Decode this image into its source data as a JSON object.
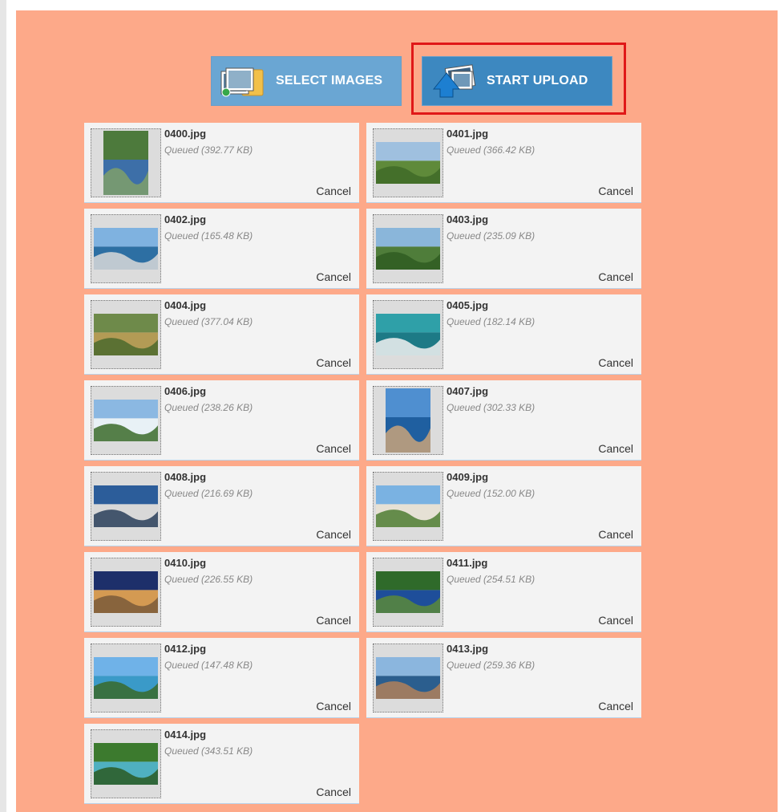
{
  "toolbar": {
    "select_label": "SELECT IMAGES",
    "start_label": "START UPLOAD"
  },
  "files": [
    {
      "name": "0400.jpg",
      "status": "Queued (392.77 KB)",
      "cancel": "Cancel",
      "orientation": "portrait",
      "scene": "canyon-river"
    },
    {
      "name": "0401.jpg",
      "status": "Queued (366.42 KB)",
      "cancel": "Cancel",
      "orientation": "landscape",
      "scene": "vineyard"
    },
    {
      "name": "0402.jpg",
      "status": "Queued (165.48 KB)",
      "cancel": "Cancel",
      "orientation": "landscape",
      "scene": "bridge-sea"
    },
    {
      "name": "0403.jpg",
      "status": "Queued (235.09 KB)",
      "cancel": "Cancel",
      "orientation": "landscape",
      "scene": "valley-fields"
    },
    {
      "name": "0404.jpg",
      "status": "Queued (377.04 KB)",
      "cancel": "Cancel",
      "orientation": "landscape",
      "scene": "terraced-fields"
    },
    {
      "name": "0405.jpg",
      "status": "Queued (182.14 KB)",
      "cancel": "Cancel",
      "orientation": "landscape",
      "scene": "boat-lagoon"
    },
    {
      "name": "0406.jpg",
      "status": "Queued (238.26 KB)",
      "cancel": "Cancel",
      "orientation": "landscape",
      "scene": "waterfall"
    },
    {
      "name": "0407.jpg",
      "status": "Queued (302.33 KB)",
      "cancel": "Cancel",
      "orientation": "portrait",
      "scene": "coastal-town"
    },
    {
      "name": "0408.jpg",
      "status": "Queued (216.69 KB)",
      "cancel": "Cancel",
      "orientation": "landscape",
      "scene": "marina"
    },
    {
      "name": "0409.jpg",
      "status": "Queued (152.00 KB)",
      "cancel": "Cancel",
      "orientation": "landscape",
      "scene": "tower-hill"
    },
    {
      "name": "0410.jpg",
      "status": "Queued (226.55 KB)",
      "cancel": "Cancel",
      "orientation": "landscape",
      "scene": "arena-night"
    },
    {
      "name": "0411.jpg",
      "status": "Queued (254.51 KB)",
      "cancel": "Cancel",
      "orientation": "landscape",
      "scene": "lake-island"
    },
    {
      "name": "0412.jpg",
      "status": "Queued (147.48 KB)",
      "cancel": "Cancel",
      "orientation": "landscape",
      "scene": "sunny-coast"
    },
    {
      "name": "0413.jpg",
      "status": "Queued (259.36 KB)",
      "cancel": "Cancel",
      "orientation": "landscape",
      "scene": "old-town-sea"
    },
    {
      "name": "0414.jpg",
      "status": "Queued (343.51 KB)",
      "cancel": "Cancel",
      "orientation": "landscape",
      "scene": "lakes-falls"
    }
  ],
  "colors": {
    "panel_bg": "#fda989",
    "item_bg": "#f3f3f3",
    "select_btn": "#6aa6d3",
    "start_btn": "#3d88c0",
    "highlight": "#e01818"
  }
}
